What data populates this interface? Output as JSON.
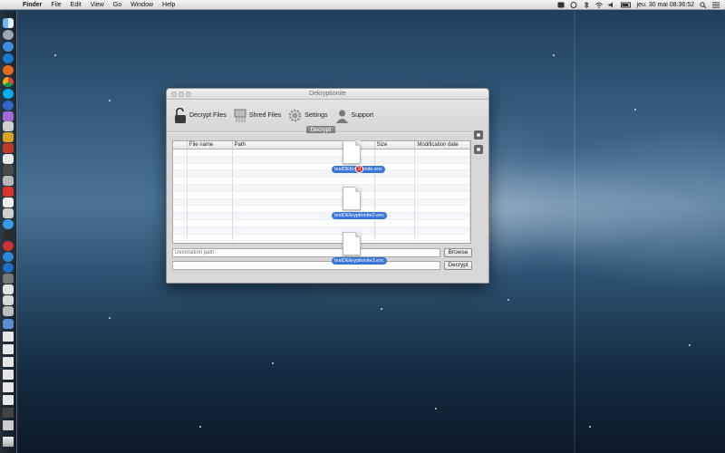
{
  "menubar": {
    "app_name": "Finder",
    "items": [
      "File",
      "Edit",
      "View",
      "Go",
      "Window",
      "Help"
    ],
    "clock": "jeu. 30 mai  08:36:52"
  },
  "window": {
    "title": "Dekryptionite",
    "toolbar": {
      "decrypt_files": "Decrypt Files",
      "shred_files": "Shred Files",
      "settings": "Settings",
      "support": "Support"
    },
    "segment_label": "Decrypt",
    "table": {
      "columns": [
        "File name",
        "Path",
        "Size",
        "Modification date"
      ]
    },
    "destination": {
      "placeholder": "Destination path",
      "browse_label": "Browse"
    },
    "password": {
      "placeholder": "",
      "decrypt_label": "Decrypt"
    }
  },
  "dragged_files": {
    "file1_label": "testDEKryptionite.enc",
    "file2_label": "testDEkryptionite2.enc",
    "file3_label": "testDEkryptionite3.enc",
    "badge_count": "3"
  },
  "colors": {
    "selection_blue": "#3a75d8",
    "badge_red": "#e0261d"
  }
}
